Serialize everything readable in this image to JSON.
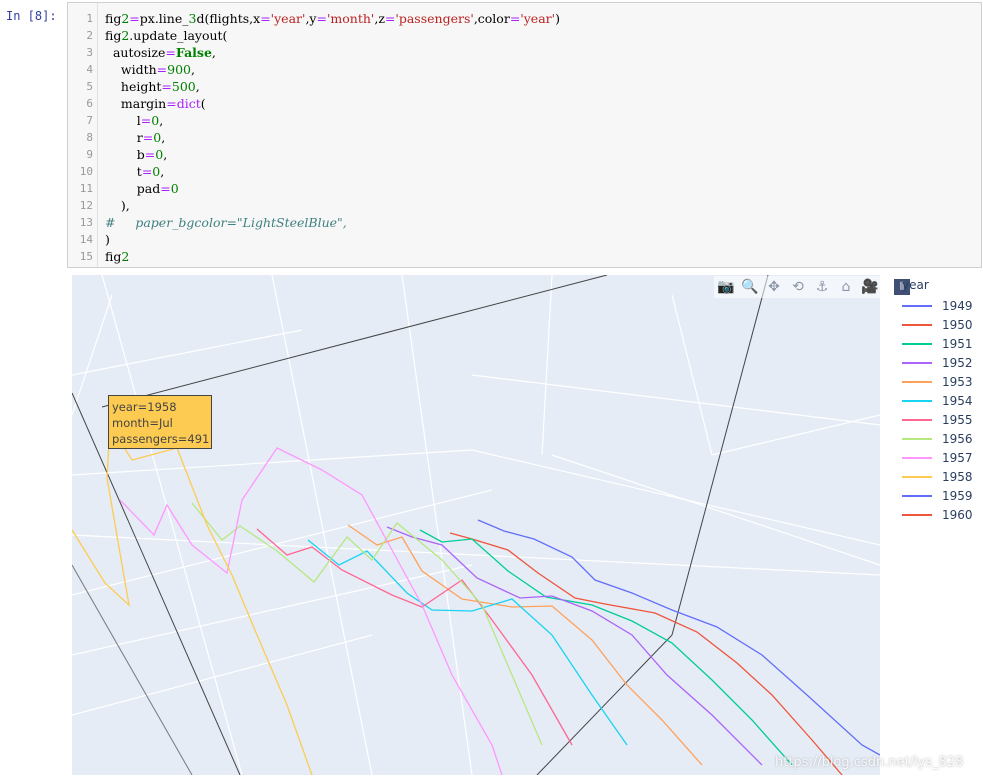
{
  "cell": {
    "prompt": "In  [8]:",
    "lines": [
      {
        "n": "1",
        "code": "fig2=px.line_3d(flights,x='year',y='month',z='passengers',color='year')"
      },
      {
        "n": "2",
        "code": "fig2.update_layout("
      },
      {
        "n": "3",
        "code": "  autosize=False,"
      },
      {
        "n": "4",
        "code": "    width=900,"
      },
      {
        "n": "5",
        "code": "    height=500,"
      },
      {
        "n": "6",
        "code": "    margin=dict("
      },
      {
        "n": "7",
        "code": "        l=0,"
      },
      {
        "n": "8",
        "code": "        r=0,"
      },
      {
        "n": "9",
        "code": "        b=0,"
      },
      {
        "n": "10",
        "code": "        t=0,"
      },
      {
        "n": "11",
        "code": "        pad=0"
      },
      {
        "n": "12",
        "code": "    ),"
      },
      {
        "n": "13",
        "code": "#     paper_bgcolor=\"LightSteelBlue\","
      },
      {
        "n": "14",
        "code": ")"
      },
      {
        "n": "15",
        "code": "fig2"
      }
    ]
  },
  "modebar": {
    "buttons": [
      {
        "icon": "camera-icon",
        "glyph": "📷"
      },
      {
        "icon": "zoom-icon",
        "glyph": "🔍"
      },
      {
        "icon": "pan-icon",
        "glyph": "✥"
      },
      {
        "icon": "orbit-rotation-icon",
        "glyph": "⟲"
      },
      {
        "icon": "turntable-rotation-icon",
        "glyph": "⚓"
      },
      {
        "icon": "reset-camera-icon",
        "glyph": "⌂"
      },
      {
        "icon": "video-camera-icon",
        "glyph": "🎥"
      }
    ],
    "logo_icon": "plotly-logo-icon"
  },
  "legend": {
    "title": "year",
    "items": [
      {
        "label": "1949",
        "color": "#636efa"
      },
      {
        "label": "1950",
        "color": "#ef553b"
      },
      {
        "label": "1951",
        "color": "#00cc96"
      },
      {
        "label": "1952",
        "color": "#ab63fa"
      },
      {
        "label": "1953",
        "color": "#ffa15a"
      },
      {
        "label": "1954",
        "color": "#19d3f3"
      },
      {
        "label": "1955",
        "color": "#ff6692"
      },
      {
        "label": "1956",
        "color": "#b6e880"
      },
      {
        "label": "1957",
        "color": "#ff97ff"
      },
      {
        "label": "1958",
        "color": "#fecb52"
      },
      {
        "label": "1959",
        "color": "#636efa"
      },
      {
        "label": "1960",
        "color": "#ef553b"
      }
    ]
  },
  "tooltip": {
    "line1": "year=1958",
    "line2": "month=Jul",
    "line3": "passengers=491"
  },
  "watermark": "https://blog.csdn.net/lys_828",
  "chart_data": {
    "type": "line",
    "dimensions": "3d",
    "x_field": "year",
    "y_field": "month",
    "z_field": "passengers",
    "color_field": "year",
    "background": "#e5ecf6"
  }
}
